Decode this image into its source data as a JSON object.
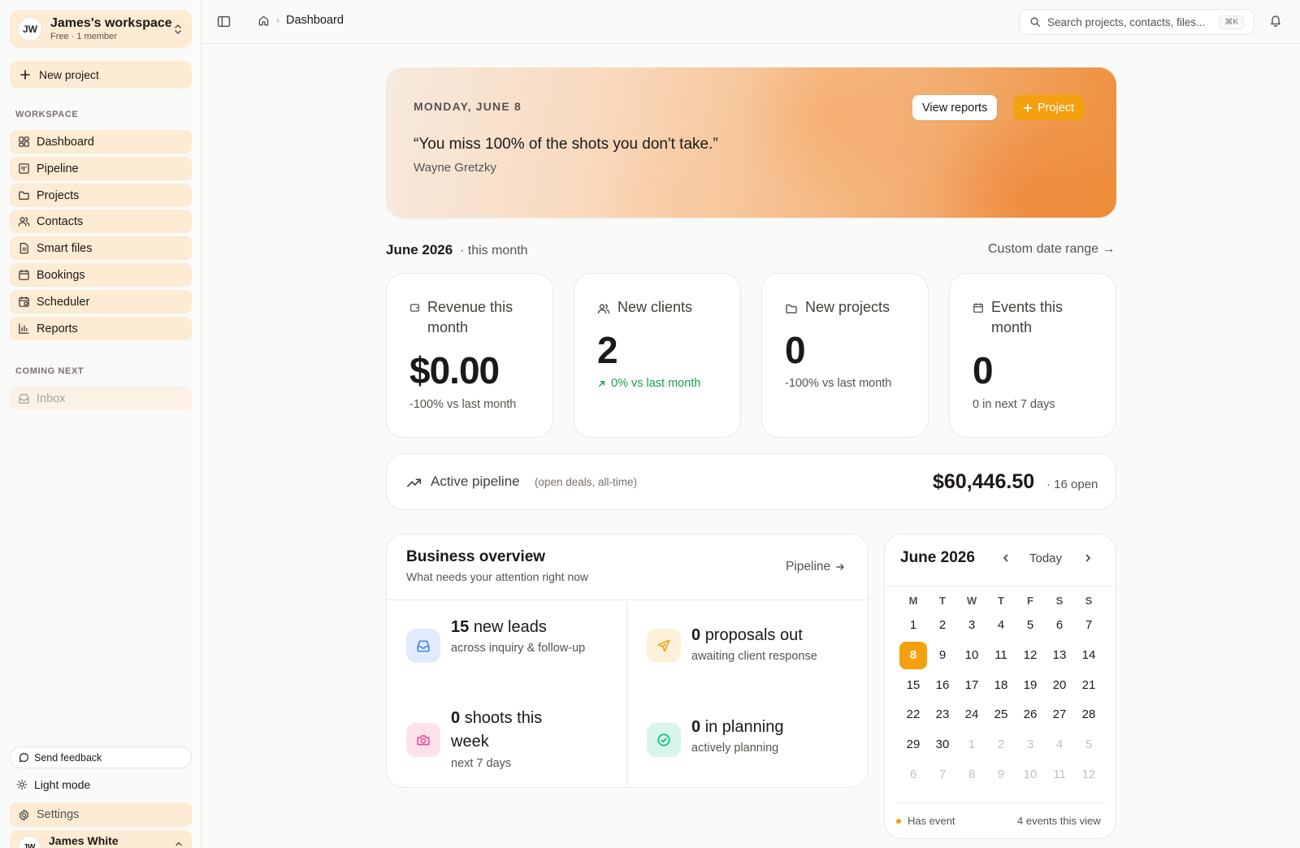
{
  "workspace": {
    "initials": "JW",
    "name": "James's workspace",
    "subtitle": "Free · 1 member"
  },
  "sidebar": {
    "new_project": "New project",
    "workspace_label": "WORKSPACE",
    "items": [
      {
        "label": "Dashboard",
        "icon": "dashboard-icon"
      },
      {
        "label": "Pipeline",
        "icon": "pipeline-icon"
      },
      {
        "label": "Projects",
        "icon": "folder-icon"
      },
      {
        "label": "Contacts",
        "icon": "users-icon"
      },
      {
        "label": "Smart files",
        "icon": "file-icon"
      },
      {
        "label": "Bookings",
        "icon": "calendar-icon"
      },
      {
        "label": "Scheduler",
        "icon": "calendar-clock-icon"
      },
      {
        "label": "Reports",
        "icon": "bar-chart-icon"
      }
    ],
    "coming_next_label": "COMING NEXT",
    "inbox": "Inbox",
    "send_feedback": "Send feedback",
    "light_mode": "Light mode",
    "settings": "Settings",
    "user": {
      "initials": "JW",
      "name": "James White"
    }
  },
  "topbar": {
    "breadcrumb_current": "Dashboard",
    "search_placeholder": "Search projects, contacts, files...",
    "search_shortcut": "⌘K"
  },
  "hero": {
    "date": "MONDAY, JUNE 8",
    "quote": "“You miss 100% of the shots you don't take.”",
    "author": "Wayne Gretzky",
    "view_reports": "View reports",
    "project_button": "Project"
  },
  "period": {
    "label": "June 2026",
    "suffix": "· this month",
    "custom_range": "Custom date range →"
  },
  "stats": [
    {
      "title": "Revenue this month",
      "value": "$0.00",
      "sub": "-100% vs last month",
      "icon": "wallet-icon"
    },
    {
      "title": "New clients",
      "value": "2",
      "sub": "0% vs last month",
      "icon": "users-icon"
    },
    {
      "title": "New projects",
      "value": "0",
      "sub": "-100% vs last month",
      "icon": "folder-icon"
    },
    {
      "title": "Events this month",
      "value": "0",
      "sub": "0 in next 7 days",
      "icon": "calendar-icon"
    }
  ],
  "pipeline": {
    "title": "Active pipeline",
    "note": "(open deals, all-time)",
    "amount": "$60,446.50",
    "open": "· 16 open"
  },
  "business": {
    "title": "Business overview",
    "subtitle": "What needs your attention right now",
    "link": "Pipeline",
    "tiles": [
      {
        "count": "15",
        "label": "new leads",
        "sub": "across inquiry & follow-up",
        "icon": "inbox-icon",
        "color": "#3b82f6"
      },
      {
        "count": "0",
        "label": "proposals out",
        "sub": "awaiting client response",
        "icon": "send-icon",
        "color": "#f59e0b"
      },
      {
        "count": "0",
        "label": "shoots this week",
        "sub": "next 7 days",
        "icon": "camera-icon",
        "color": "#ec4899"
      },
      {
        "count": "0",
        "label": "in planning",
        "sub": "actively planning",
        "icon": "check-circle-icon",
        "color": "#10b981"
      }
    ]
  },
  "calendar": {
    "title": "June 2026",
    "today": "Today",
    "weekdays": [
      "M",
      "T",
      "W",
      "T",
      "F",
      "S",
      "S"
    ],
    "weeks": [
      [
        "1",
        "2",
        "3",
        "4",
        "5",
        "6",
        "7"
      ],
      [
        "8",
        "9",
        "10",
        "11",
        "12",
        "13",
        "14"
      ],
      [
        "15",
        "16",
        "17",
        "18",
        "19",
        "20",
        "21"
      ],
      [
        "22",
        "23",
        "24",
        "25",
        "26",
        "27",
        "28"
      ],
      [
        "29",
        "30",
        "1",
        "2",
        "3",
        "4",
        "5"
      ],
      [
        "6",
        "7",
        "8",
        "9",
        "10",
        "11",
        "12"
      ]
    ],
    "selected_day": "8",
    "legend": "Has event",
    "count": "4 events this view",
    "accent": "#f5a00f"
  }
}
